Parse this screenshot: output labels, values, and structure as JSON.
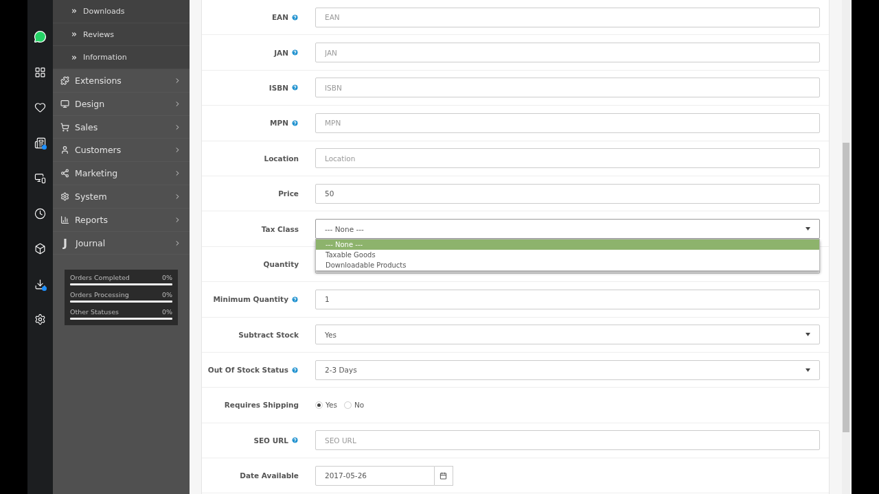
{
  "icon_rail": [
    {
      "kind": "whatsapp",
      "badge": false
    },
    {
      "kind": "grid",
      "badge": false
    },
    {
      "kind": "heart",
      "badge": false
    },
    {
      "kind": "news",
      "badge": true
    },
    {
      "kind": "devices",
      "badge": false
    },
    {
      "kind": "clock",
      "badge": false
    },
    {
      "kind": "box",
      "badge": false
    },
    {
      "kind": "download",
      "badge": true
    },
    {
      "kind": "settings",
      "badge": false
    }
  ],
  "sidebar": {
    "items": [
      {
        "kind": "sub",
        "label": "Downloads"
      },
      {
        "kind": "sub",
        "label": "Reviews"
      },
      {
        "kind": "sub",
        "label": "Information"
      },
      {
        "kind": "main",
        "label": "Extensions"
      },
      {
        "kind": "main",
        "label": "Design"
      },
      {
        "kind": "main",
        "label": "Sales"
      },
      {
        "kind": "main",
        "label": "Customers"
      },
      {
        "kind": "main",
        "label": "Marketing"
      },
      {
        "kind": "main",
        "label": "System"
      },
      {
        "kind": "main",
        "label": "Reports"
      },
      {
        "kind": "main",
        "icon_text": "J",
        "label": "Journal"
      }
    ],
    "stats": [
      {
        "label": "Orders Completed",
        "value": "0%",
        "level": 0
      },
      {
        "label": "Orders Processing",
        "value": "0%",
        "level": 0
      },
      {
        "label": "Other Statuses",
        "value": "0%",
        "level": 0
      }
    ]
  },
  "form": {
    "fields": [
      {
        "kind": "text",
        "label": "EAN",
        "help": true,
        "placeholder": "EAN"
      },
      {
        "kind": "text",
        "label": "JAN",
        "help": true,
        "placeholder": "JAN"
      },
      {
        "kind": "text",
        "label": "ISBN",
        "help": true,
        "placeholder": "ISBN"
      },
      {
        "kind": "text",
        "label": "MPN",
        "help": true,
        "placeholder": "MPN"
      },
      {
        "kind": "text",
        "label": "Location",
        "help": false,
        "placeholder": "Location"
      },
      {
        "kind": "text",
        "label": "Price",
        "help": false,
        "value": "50"
      },
      {
        "kind": "select",
        "label": "Tax Class",
        "help": false,
        "value": "--- None ---",
        "expanded": true,
        "options": [
          {
            "label": "--- None ---",
            "selected": true
          },
          {
            "label": "Taxable Goods",
            "selected": false
          },
          {
            "label": "Downloadable Products",
            "selected": false
          }
        ]
      },
      {
        "kind": "text",
        "label": "Quantity",
        "help": false
      },
      {
        "kind": "text",
        "label": "Minimum Quantity",
        "help": true,
        "value": "1"
      },
      {
        "kind": "select",
        "label": "Subtract Stock",
        "help": false,
        "value": "Yes",
        "expanded": false
      },
      {
        "kind": "select",
        "label": "Out Of Stock Status",
        "help": true,
        "value": "2-3 Days",
        "expanded": false
      },
      {
        "kind": "radio",
        "label": "Requires Shipping",
        "help": false,
        "options": [
          {
            "label": "Yes",
            "selected": true
          },
          {
            "label": "No",
            "selected": false
          }
        ]
      },
      {
        "kind": "text",
        "label": "SEO URL",
        "help": true,
        "placeholder": "SEO URL"
      },
      {
        "kind": "date",
        "label": "Date Available",
        "help": false,
        "value": "2017-05-26"
      }
    ]
  }
}
